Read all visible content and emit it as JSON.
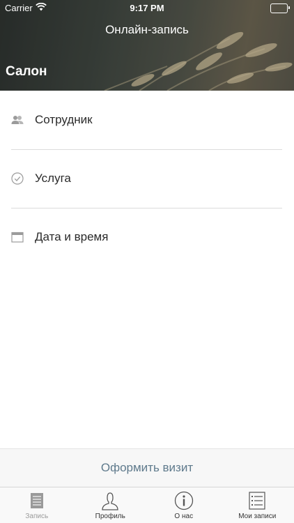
{
  "status_bar": {
    "carrier": "Carrier",
    "time": "9:17 PM"
  },
  "header": {
    "nav_title": "Онлайн-запись",
    "section_title": "Салон"
  },
  "menu": {
    "items": [
      {
        "label": "Сотрудник",
        "icon": "people-icon"
      },
      {
        "label": "Услуга",
        "icon": "check-circle-icon"
      },
      {
        "label": "Дата и время",
        "icon": "calendar-icon"
      }
    ]
  },
  "visit_button_label": "Оформить визит",
  "tabbar": {
    "tabs": [
      {
        "label": "Запись",
        "icon": "document-icon",
        "active": true
      },
      {
        "label": "Профиль",
        "icon": "person-icon",
        "active": false
      },
      {
        "label": "О нас",
        "icon": "info-icon",
        "active": false
      },
      {
        "label": "Мои записи",
        "icon": "list-icon",
        "active": false
      }
    ]
  },
  "colors": {
    "accent": "#5f7a8c",
    "separator": "#dcdcdc",
    "icon_gray": "#9b9b9b"
  }
}
